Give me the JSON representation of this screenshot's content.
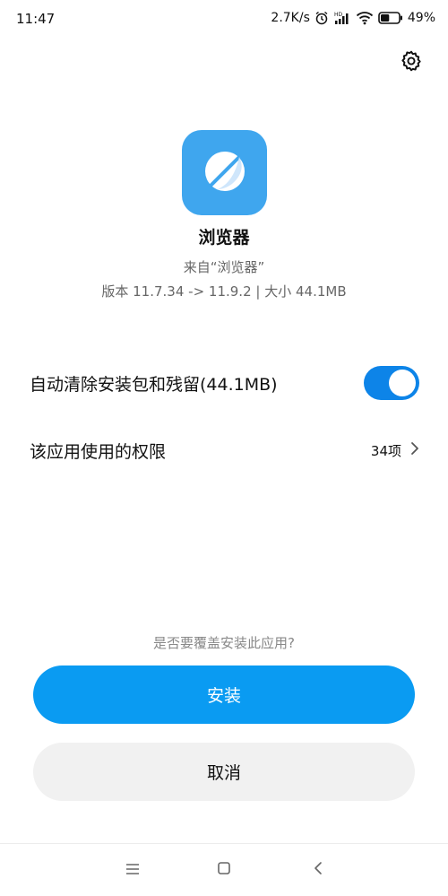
{
  "status_bar": {
    "time": "11:47",
    "network_speed": "2.7K/s",
    "battery_percent": "49%",
    "battery_level": 0.49,
    "icons": [
      "alarm-icon",
      "signal-hd-icon",
      "wifi-icon",
      "battery-icon"
    ]
  },
  "header": {
    "settings_icon": "gear-icon"
  },
  "app": {
    "name": "浏览器",
    "source": "来自“浏览器”",
    "version_info": "版本 11.7.34 -> 11.9.2 | 大小 44.1MB",
    "icon": "browser-globe-icon",
    "icon_color": "#3fa6ee"
  },
  "options": {
    "cleanup_label": "自动清除安装包和残留(44.1MB)",
    "cleanup_enabled": true,
    "permissions_label": "该应用使用的权限",
    "permissions_count": "34项"
  },
  "confirm": {
    "question": "是否要覆盖安装此应用?",
    "install_label": "安装",
    "cancel_label": "取消"
  },
  "colors": {
    "accent": "#0a9bf2",
    "toggle_on": "#0d84e8"
  },
  "nav_bar": {
    "icons": [
      "menu-icon",
      "home-icon",
      "back-icon"
    ]
  }
}
